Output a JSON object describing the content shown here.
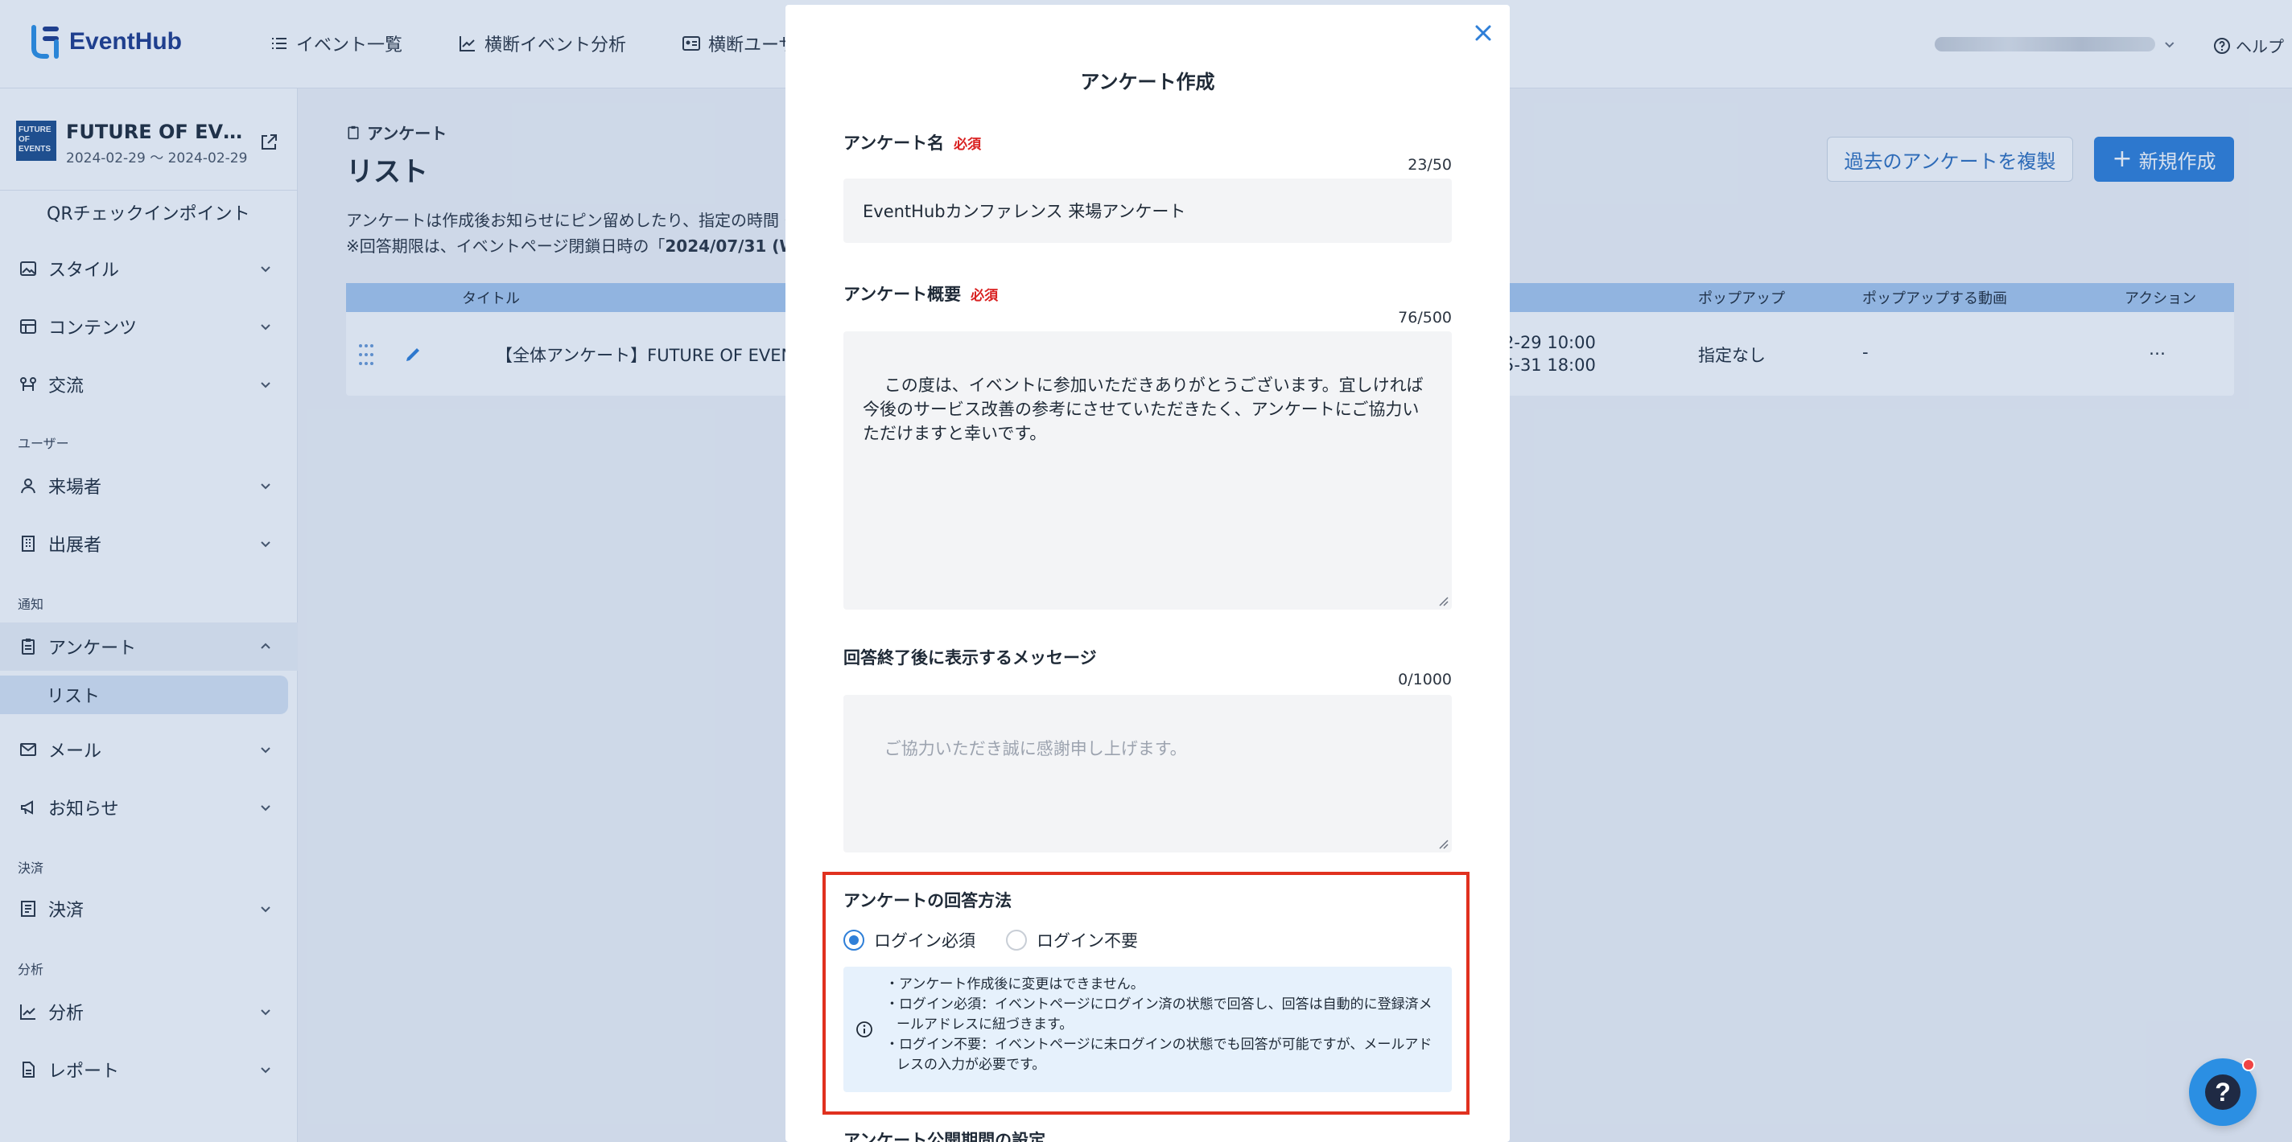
{
  "header": {
    "logo_text": "EventHub",
    "nav": [
      {
        "label": "イベント一覧",
        "icon": "list-icon"
      },
      {
        "label": "横断イベント分析",
        "icon": "chart-line-icon"
      },
      {
        "label": "横断ユーザー",
        "icon": "id-card-icon"
      }
    ],
    "help_label": "ヘルプ"
  },
  "sidebar": {
    "event_title": "FUTURE OF EVENTS",
    "event_date": "2024-02-29 〜 2024-02-29",
    "thumb_text": "FUTURE OF EVENTS",
    "items": [
      {
        "label": "QRチェックインポイント"
      },
      {
        "label": "スタイル",
        "icon": "image-icon"
      },
      {
        "label": "コンテンツ",
        "icon": "table-icon"
      },
      {
        "label": "交流",
        "icon": "handshake-icon"
      },
      {
        "label": "来場者",
        "icon": "user-icon"
      },
      {
        "label": "出展者",
        "icon": "building-icon"
      },
      {
        "label": "アンケート",
        "icon": "clipboard-icon"
      },
      {
        "label": "リスト"
      },
      {
        "label": "メール",
        "icon": "mail-icon"
      },
      {
        "label": "お知らせ",
        "icon": "megaphone-icon"
      },
      {
        "label": "決済",
        "icon": "receipt-icon"
      },
      {
        "label": "分析",
        "icon": "chart-line-icon"
      },
      {
        "label": "レポート",
        "icon": "file-icon"
      }
    ],
    "sections": {
      "users": "ユーザー",
      "notify": "通知",
      "payment": "決済",
      "analysis": "分析"
    }
  },
  "main": {
    "breadcrumb": "アンケート",
    "title": "リスト",
    "desc_line1": "アンケートは作成後お知らせにピン留めしたり、指定の時間・",
    "desc_line2_prefix": "※回答期限は、イベントページ閉鎖日時の「",
    "desc_line2_bold": "2024/07/31 (W",
    "copy_button": "過去のアンケートを複製",
    "new_button": "新規作成",
    "table": {
      "headers": {
        "title": "タイトル",
        "popup": "ポップアップ",
        "popup_video": "ポップアップする動画",
        "action": "アクション"
      },
      "row": {
        "title": "【全体アンケート】FUTURE OF EVEN",
        "period_start": "2-29 10:00",
        "period_end": "5-31 18:00",
        "popup": "指定なし",
        "popup_video": "-",
        "action": "…"
      }
    }
  },
  "modal": {
    "title": "アンケート作成",
    "name_label": "アンケート名",
    "required": "必須",
    "name_counter": "23/50",
    "name_value": "EventHubカンファレンス 来場アンケート",
    "summary_label": "アンケート概要",
    "summary_counter": "76/500",
    "summary_value": "この度は、イベントに参加いただきありがとうございます。宜しければ今後のサービス改善の参考にさせていただきたく、アンケートにご協力いただけますと幸いです。",
    "message_label": "回答終了後に表示するメッセージ",
    "message_counter": "0/1000",
    "message_placeholder": "ご協力いただき誠に感謝申し上げます。",
    "method_label": "アンケートの回答方法",
    "option_login_required": "ログイン必須",
    "option_login_not_required": "ログイン不要",
    "selected_option": "ログイン必須",
    "info_lines": [
      "・アンケート作成後に変更はできません。",
      "・ログイン必須：イベントページにログイン済の状態で回答し、回答は自動的に登録済メールアドレスに紐づきます。",
      "・ログイン不要：イベントページに未ログインの状態でも回答が可能ですが、メールアドレスの入力が必要です。"
    ],
    "period_label": "アンケート公開期間の設定"
  },
  "colors": {
    "accent": "#2f7fd8",
    "required": "#d92020",
    "highlight": "#e0311f"
  }
}
